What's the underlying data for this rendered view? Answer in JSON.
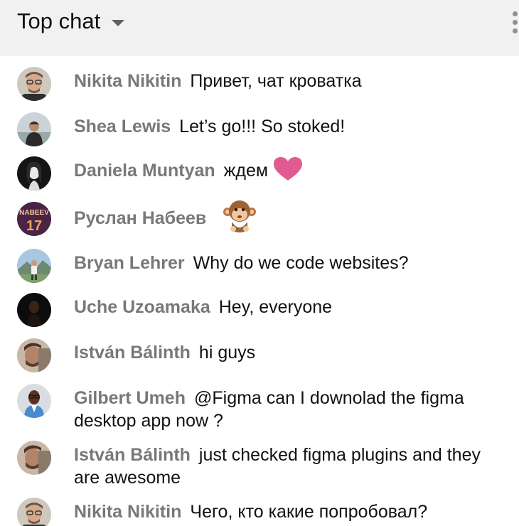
{
  "header": {
    "title": "Top chat",
    "more_icon": "more-vert-icon",
    "dropdown_icon": "caret-down-icon"
  },
  "messages": [
    {
      "author": "Nikita Nikitin",
      "text": "Привет, чат кроватка",
      "avatar": "avatar-nikita"
    },
    {
      "author": "Shea Lewis",
      "text": "Let’s go!!! So stoked!",
      "avatar": "avatar-shea"
    },
    {
      "author": "Daniela Muntyan",
      "text": "ждем",
      "emoji": "heart-icon",
      "avatar": "avatar-daniela"
    },
    {
      "author": "Руслан Набеев",
      "text": "",
      "emoji": "monkey-icon",
      "avatar": "avatar-ruslan",
      "avatar_text_top": "NABEEV",
      "avatar_text_bottom": "17"
    },
    {
      "author": "Bryan Lehrer",
      "text": "Why do we code websites?",
      "avatar": "avatar-bryan"
    },
    {
      "author": "Uche Uzoamaka",
      "text": "Hey, everyone",
      "avatar": "avatar-uche"
    },
    {
      "author": "István Bálinth",
      "text": "hi guys",
      "avatar": "avatar-istvan"
    },
    {
      "author": "Gilbert Umeh",
      "text": "@Figma can I downolad the figma desktop app now ?",
      "avatar": "avatar-gilbert"
    },
    {
      "author": "István Bálinth",
      "text": "just checked figma plugins and they are awesome",
      "avatar": "avatar-istvan"
    },
    {
      "author": "Nikita Nikitin",
      "text": "Чего, кто какие попробовал?",
      "avatar": "avatar-nikita"
    }
  ],
  "colors": {
    "header_bg": "#f1f1f1",
    "author": "#787878",
    "text": "#111111",
    "heart": "#e25a8f"
  }
}
